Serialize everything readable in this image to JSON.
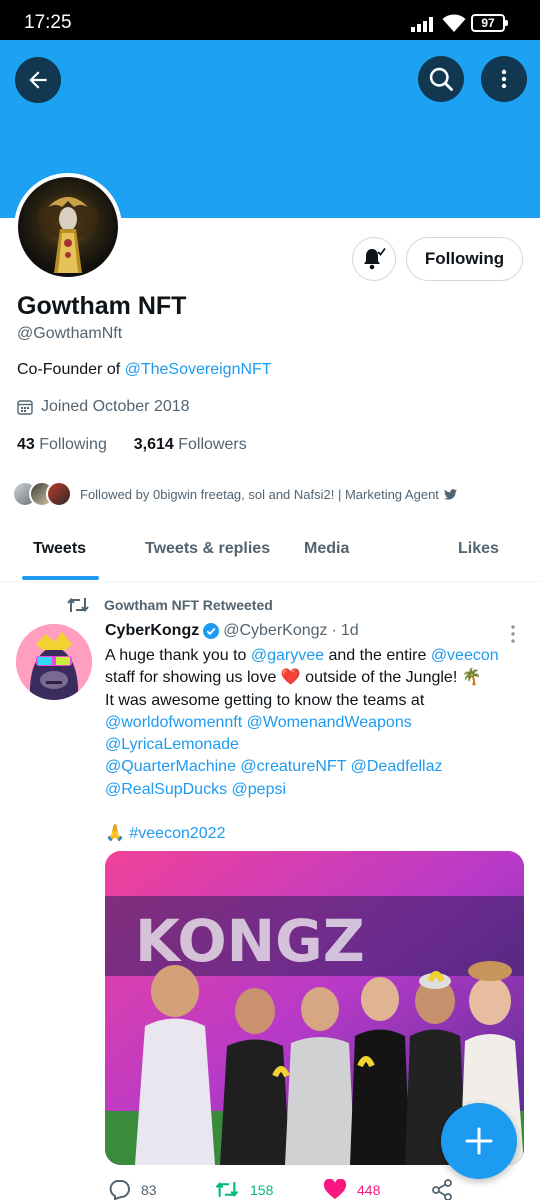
{
  "status_bar": {
    "time": "17:25",
    "battery": "97"
  },
  "profile": {
    "name": "Gowtham NFT",
    "handle": "@GowthamNft",
    "bio_prefix": "Co-Founder of ",
    "bio_link": "@TheSovereignNFT",
    "joined": "Joined October 2018",
    "following_count": "43",
    "following_label": "Following",
    "followers_count": "3,614",
    "followers_label": "Followers",
    "followed_by": "Followed by 0bigwin freetag, sol and Nafsi2! | Marketing Agent",
    "follow_button": "Following"
  },
  "tabs": [
    {
      "label": "Tweets",
      "active": true
    },
    {
      "label": "Tweets & replies",
      "active": false
    },
    {
      "label": "Media",
      "active": false
    },
    {
      "label": "Likes",
      "active": false
    }
  ],
  "tweet": {
    "retweet_context": "Gowtham NFT Retweeted",
    "author_name": "CyberKongz",
    "author_handle": "@CyberKongz",
    "separator": "·",
    "time": "1d",
    "text_1": "A huge thank you to ",
    "mention_1": "@garyvee",
    "text_2": " and the entire ",
    "mention_2": "@veecon",
    "text_3": "\nstaff for showing us love ",
    "emoji_heart": "❤️",
    "text_4": " outside of the Jungle! ",
    "emoji_palm": "🌴",
    "text_5": "\nIt was awesome getting to know the teams at\n",
    "mention_3": "@worldofwomennft",
    "mention_4": "@WomenandWeapons",
    "mention_5": "@LyricaLemonade",
    "mention_6": "@QuarterMachine",
    "mention_7": "@creatureNFT",
    "mention_8": "@Deadfellaz",
    "mention_9": "@RealSupDucks",
    "mention_10": "@pepsi",
    "emoji_pray": "🙏",
    "hashtag": "#veecon2022",
    "replies": "83",
    "retweets": "158",
    "likes": "448"
  },
  "colors": {
    "banner": "#1da1f2",
    "accent": "#1d9bf0",
    "retweet_green": "#00ba7c",
    "like_pink": "#f91880",
    "secondary_text": "#536471"
  },
  "icons": {
    "back": "arrow-left-icon",
    "search": "search-icon",
    "more": "more-vertical-icon",
    "notifications": "bell-check-icon",
    "calendar": "calendar-icon",
    "retweet": "retweet-icon",
    "compose": "plus-icon",
    "reply": "reply-icon",
    "like": "heart-icon",
    "share": "share-icon"
  }
}
